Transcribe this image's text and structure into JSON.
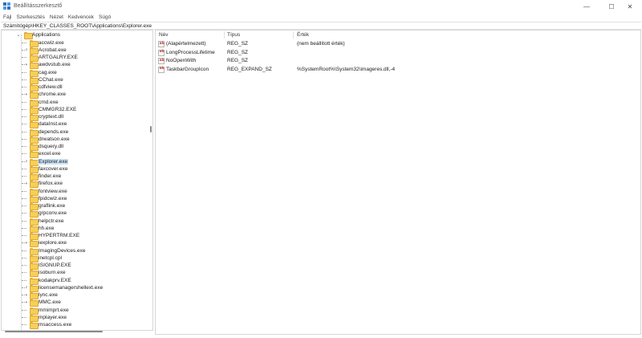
{
  "window": {
    "title": "Beállításszerkesztő",
    "controls": {
      "minimize": "—",
      "maximize": "☐",
      "close": "✕"
    }
  },
  "menu": [
    "Fájl",
    "Szerkesztés",
    "Nézet",
    "Kedvencek",
    "Súgó"
  ],
  "address": "Számítógép\\HKEY_CLASSES_ROOT\\Applications\\Explorer.exe",
  "tree": {
    "root": "Applications",
    "selected": "Explorer.exe",
    "items": [
      "accwiz.exe",
      "Acrobat.exe",
      "ARTGALRY.EXE",
      "awdvstub.exe",
      "cag.exe",
      "CChat.exe",
      "cdfview.dll",
      "chrome.exe",
      "cmd.exe",
      "CMMGR32.EXE",
      "cryptext.dll",
      "dataInst.exe",
      "depends.exe",
      "drwatson.exe",
      "dsquery.dll",
      "excel.exe",
      "Explorer.exe",
      "faxcover.exe",
      "finder.exe",
      "firefox.exe",
      "fontview.exe",
      "fpidcwiz.exe",
      "graflink.exe",
      "grpconv.exe",
      "helpctr.exe",
      "hh.exe",
      "HYPERTRM.EXE",
      "iexplore.exe",
      "ImagingDevices.exe",
      "inetcpl.cpl",
      "ISIGNUP.EXE",
      "isoburn.exe",
      "kodakprv.EXE",
      "licensemanagershellext.exe",
      "lync.exe",
      "MMC.exe",
      "mmimprt.exe",
      "mplayer.exe",
      "msaccess.exe"
    ]
  },
  "list": {
    "columns": {
      "name": "Név",
      "type": "Típus",
      "data": "Érték"
    },
    "rows": [
      {
        "name": "(Alapértelmezett)",
        "type": "REG_SZ",
        "data": "(nem beállított érték)"
      },
      {
        "name": "LongProcessLifetime",
        "type": "REG_SZ",
        "data": ""
      },
      {
        "name": "NoOpenWith",
        "type": "REG_SZ",
        "data": ""
      },
      {
        "name": "TaskbarGroupIcon",
        "type": "REG_EXPAND_SZ",
        "data": "%SystemRoot%\\System32\\imageres.dll,-4"
      }
    ],
    "icon_glyph": "ab"
  },
  "colors": {
    "selection": "#cce4f7",
    "folder": "#f6cf56",
    "value_icon_text": "#c0392b"
  }
}
